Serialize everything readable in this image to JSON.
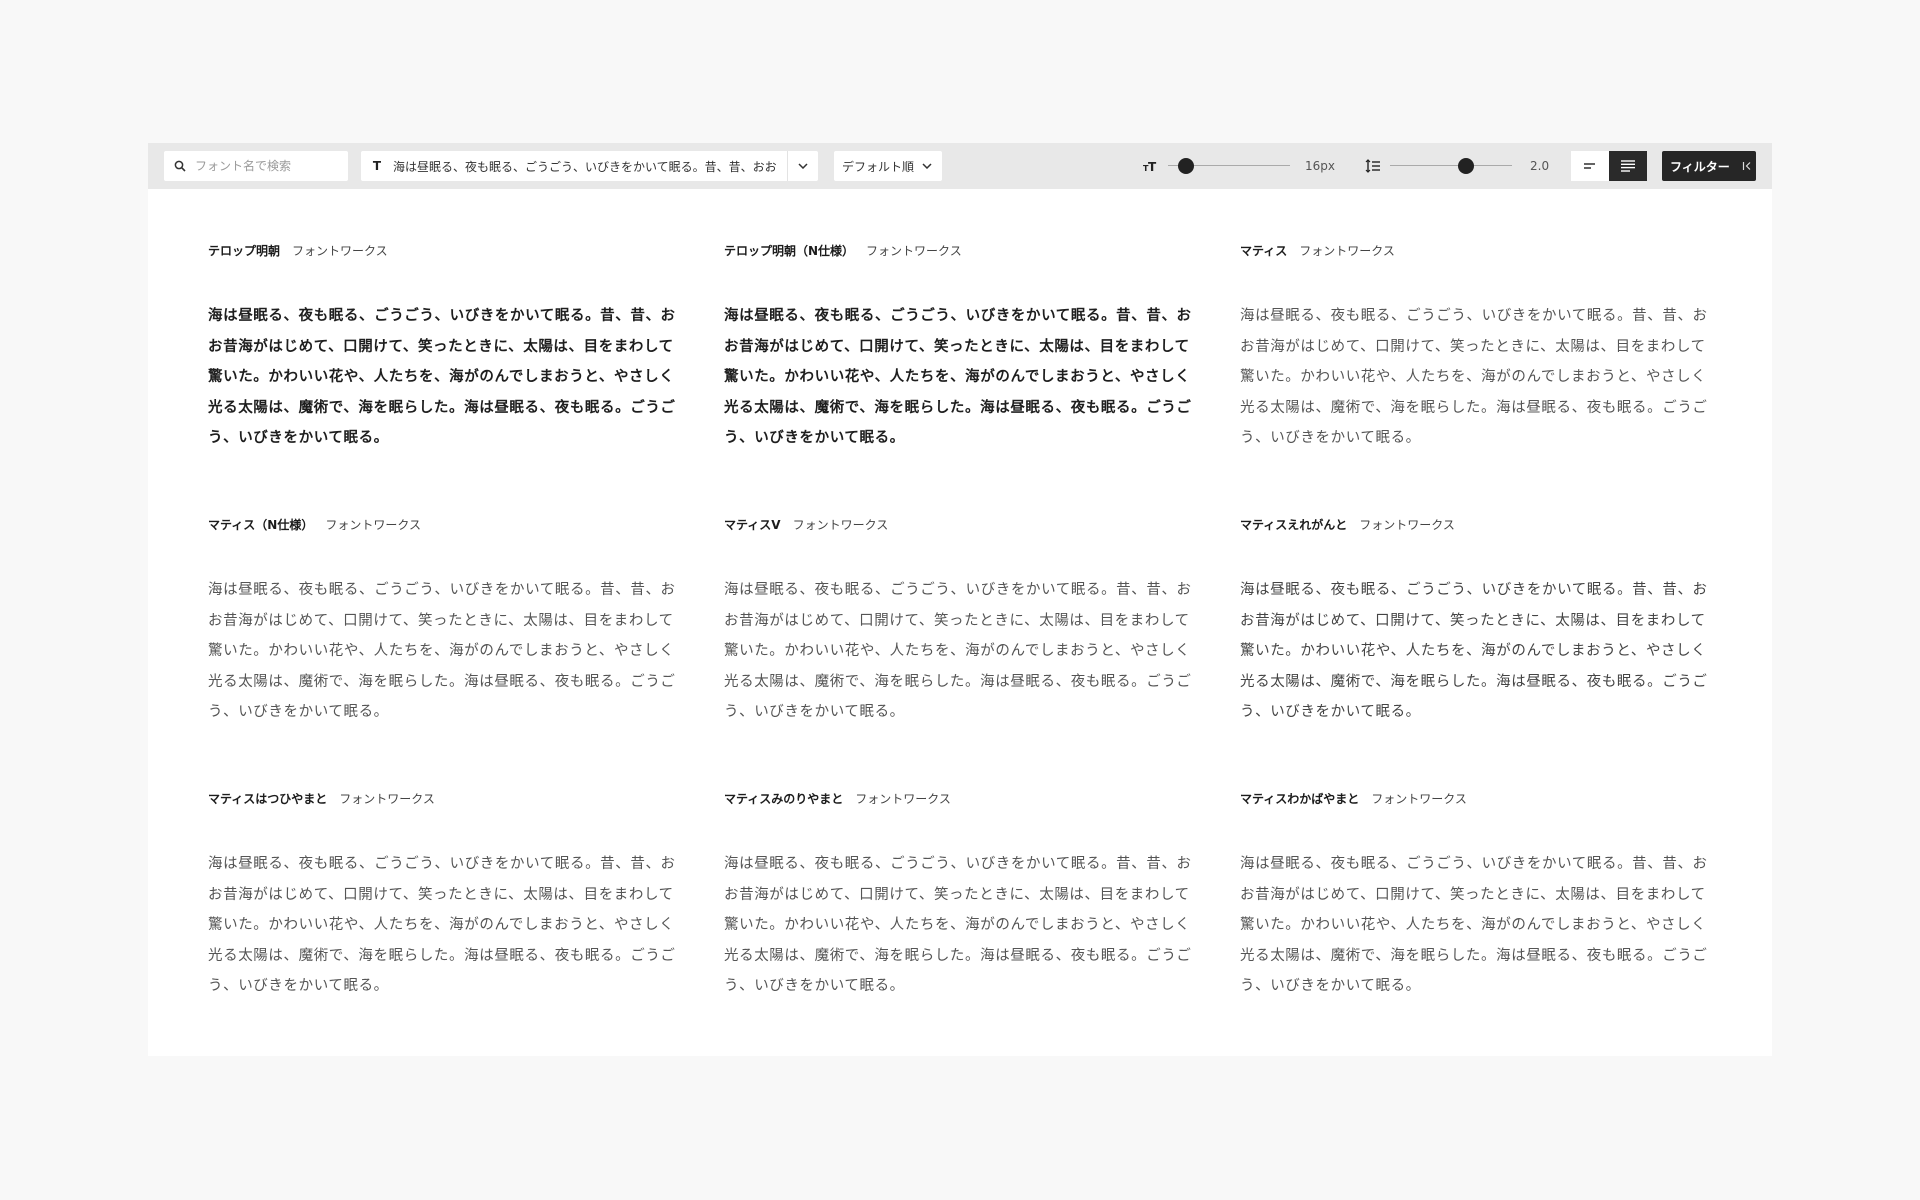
{
  "toolbar": {
    "search_placeholder": "フォント名で検索",
    "sample_icon": "T",
    "sample_text": "海は昼眠る、夜も眠る、ごうごう、いびきをかいて眠る。昔、昔、おお",
    "sort_label": "デフォルト順",
    "font_size": {
      "icon": "font-size-icon",
      "value_label": "16px",
      "level": 0.15
    },
    "line_height": {
      "icon": "line-height-icon",
      "value_label": "2.0",
      "level": 0.62
    },
    "align_left_icon": "align-left-icon",
    "align_justify_icon": "align-justify-icon",
    "filter_label": "フィルター",
    "filter_collapse_icon": "collapse-left-icon"
  },
  "colors": {
    "toolbar_bg": "#e8e8e8",
    "accent_dark": "#262626",
    "page_bg": "#f8f8f8"
  },
  "fonts": [
    {
      "name": "テロップ明朝",
      "foundry": "フォントワークス",
      "style": "bold",
      "sample": "海は昼眠る、夜も眠る、ごうごう、いびきをかいて眠る。昔、昔、おお昔海がはじめて、口開けて、笑ったときに、太陽は、目をまわして驚いた。かわいい花や、人たちを、海がのんでしまおうと、やさしく光る太陽は、魔術で、海を眠らした。海は昼眠る、夜も眠る。ごうごう、いびきをかいて眠る。"
    },
    {
      "name": "テロップ明朝（N仕様）",
      "foundry": "フォントワークス",
      "style": "bold",
      "sample": "海は昼眠る、夜も眠る、ごうごう、いびきをかいて眠る。昔、昔、おお昔海がはじめて、口開けて、笑ったときに、太陽は、目をまわして驚いた。かわいい花や、人たちを、海がのんでしまおうと、やさしく光る太陽は、魔術で、海を眠らした。海は昼眠る、夜も眠る。ごうごう、いびきをかいて眠る。"
    },
    {
      "name": "マティス",
      "foundry": "フォントワークス",
      "style": "light",
      "sample": "海は昼眠る、夜も眠る、ごうごう、いびきをかいて眠る。昔、昔、おお昔海がはじめて、口開けて、笑ったときに、太陽は、目をまわして驚いた。かわいい花や、人たちを、海がのんでしまおうと、やさしく光る太陽は、魔術で、海を眠らした。海は昼眠る、夜も眠る。ごうごう、いびきをかいて眠る。"
    },
    {
      "name": "マティス（N仕様）",
      "foundry": "フォントワークス",
      "style": "light",
      "sample": "海は昼眠る、夜も眠る、ごうごう、いびきをかいて眠る。昔、昔、おお昔海がはじめて、口開けて、笑ったときに、太陽は、目をまわして驚いた。かわいい花や、人たちを、海がのんでしまおうと、やさしく光る太陽は、魔術で、海を眠らした。海は昼眠る、夜も眠る。ごうごう、いびきをかいて眠る。"
    },
    {
      "name": "マティスV",
      "foundry": "フォントワークス",
      "style": "light",
      "sample": "海は昼眠る、夜も眠る、ごうごう、いびきをかいて眠る。昔、昔、おお昔海がはじめて、口開けて、笑ったときに、太陽は、目をまわして驚いた。かわいい花や、人たちを、海がのんでしまおうと、やさしく光る太陽は、魔術で、海を眠らした。海は昼眠る、夜も眠る。ごうごう、いびきをかいて眠る。"
    },
    {
      "name": "マティスえれがんと",
      "foundry": "フォントワークス",
      "style": "sans",
      "sample": "海は昼眠る、夜も眠る、ごうごう、いびきをかいて眠る。昔、昔、おお昔海がはじめて、口開けて、笑ったときに、太陽は、目をまわして驚いた。かわいい花や、人たちを、海がのんでしまおうと、やさしく光る太陽は、魔術で、海を眠らした。海は昼眠る、夜も眠る。ごうごう、いびきをかいて眠る。"
    },
    {
      "name": "マティスはつひやまと",
      "foundry": "フォントワークス",
      "style": "light",
      "sample": "海は昼眠る、夜も眠る、ごうごう、いびきをかいて眠る。昔、昔、おお昔海がはじめて、口開けて、笑ったときに、太陽は、目をまわして驚いた。かわいい花や、人たちを、海がのんでしまおうと、やさしく光る太陽は、魔術で、海を眠らした。海は昼眠る、夜も眠る。ごうごう、いびきをかいて眠る。"
    },
    {
      "name": "マティスみのりやまと",
      "foundry": "フォントワークス",
      "style": "light",
      "sample": "海は昼眠る、夜も眠る、ごうごう、いびきをかいて眠る。昔、昔、おお昔海がはじめて、口開けて、笑ったときに、太陽は、目をまわして驚いた。かわいい花や、人たちを、海がのんでしまおうと、やさしく光る太陽は、魔術で、海を眠らした。海は昼眠る、夜も眠る。ごうごう、いびきをかいて眠る。"
    },
    {
      "name": "マティスわかばやまと",
      "foundry": "フォントワークス",
      "style": "light",
      "sample": "海は昼眠る、夜も眠る、ごうごう、いびきをかいて眠る。昔、昔、おお昔海がはじめて、口開けて、笑ったときに、太陽は、目をまわして驚いた。かわいい花や、人たちを、海がのんでしまおうと、やさしく光る太陽は、魔術で、海を眠らした。海は昼眠る、夜も眠る。ごうごう、いびきをかいて眠る。"
    }
  ]
}
